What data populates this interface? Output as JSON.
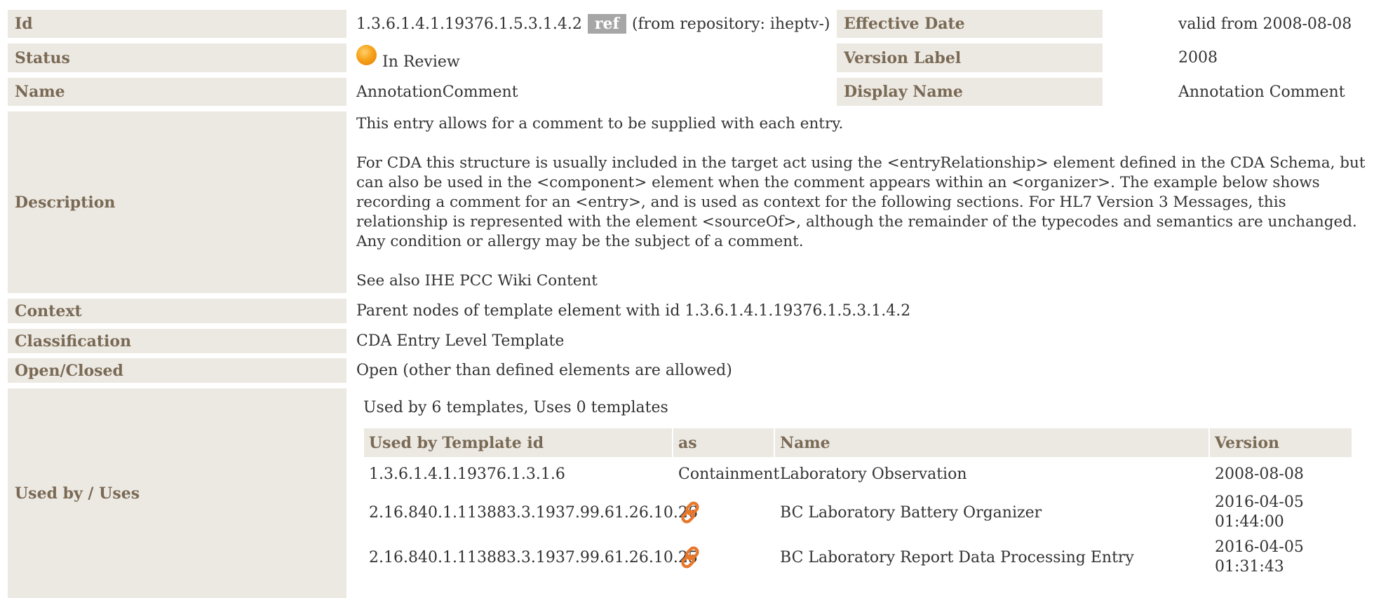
{
  "meta": {
    "id_label": "Id",
    "id_value": "1.3.6.1.4.1.19376.1.5.3.1.4.2",
    "ref_badge": "ref",
    "repository_note": "(from repository: iheptv-)",
    "effective_date_label": "Effective Date",
    "effective_date_value": "valid from 2008-08-08",
    "status_label": "Status",
    "status_value": "In Review",
    "version_label_label": "Version Label",
    "version_label_value": "2008",
    "name_label": "Name",
    "name_value": "AnnotationComment",
    "display_name_label": "Display Name",
    "display_name_value": "Annotation Comment",
    "description_label": "Description",
    "description_p1": "This entry allows for a comment to be supplied with each entry.",
    "description_p2": "For CDA this structure is usually included in the target act using the <entryRelationship> element defined in the CDA Schema, but can also be used in the <component> element when the comment appears within an <organizer>. The example below shows recording a comment for an <entry>, and is used as context for the following sections. For HL7 Version 3 Messages, this relationship is represented with the element <sourceOf>, although the remainder of the typecodes and semantics are unchanged. Any condition or allergy may be the subject of a comment.",
    "description_p3": "See also IHE PCC Wiki Content",
    "context_label": "Context",
    "context_value": "Parent nodes of template element with id 1.3.6.1.4.1.19376.1.5.3.1.4.2",
    "classification_label": "Classification",
    "classification_value": "CDA Entry Level Template",
    "open_closed_label": "Open/Closed",
    "open_closed_value": "Open (other than defined elements are allowed)",
    "used_by_label": "Used by / Uses"
  },
  "usage": {
    "summary": "Used by 6 templates, Uses 0 templates",
    "headers": {
      "template_id": "Used by Template id",
      "as": "as",
      "name": "Name",
      "version": "Version"
    },
    "rows": [
      {
        "template_id": "1.3.6.1.4.1.19376.1.3.1.6",
        "as": "Containment",
        "name": "Laboratory Observation",
        "version": "2008-08-08"
      },
      {
        "template_id": "2.16.840.1.113883.3.1937.99.61.26.10.26",
        "as_icon": "link-icon",
        "name": "BC Laboratory Battery Organizer",
        "version": "2016-04-05 01:44:00"
      },
      {
        "template_id": "2.16.840.1.113883.3.1937.99.61.26.10.25",
        "as_icon": "link-icon",
        "name": "BC Laboratory Report Data Processing Entry",
        "version": "2016-04-05 01:31:43"
      }
    ]
  },
  "colors": {
    "label_bg": "#ece9e3",
    "label_text": "#7a6a55",
    "ref_badge_bg": "#a6a6a6",
    "status_orange": "#f7a21a",
    "link_icon": "#e8772a"
  }
}
